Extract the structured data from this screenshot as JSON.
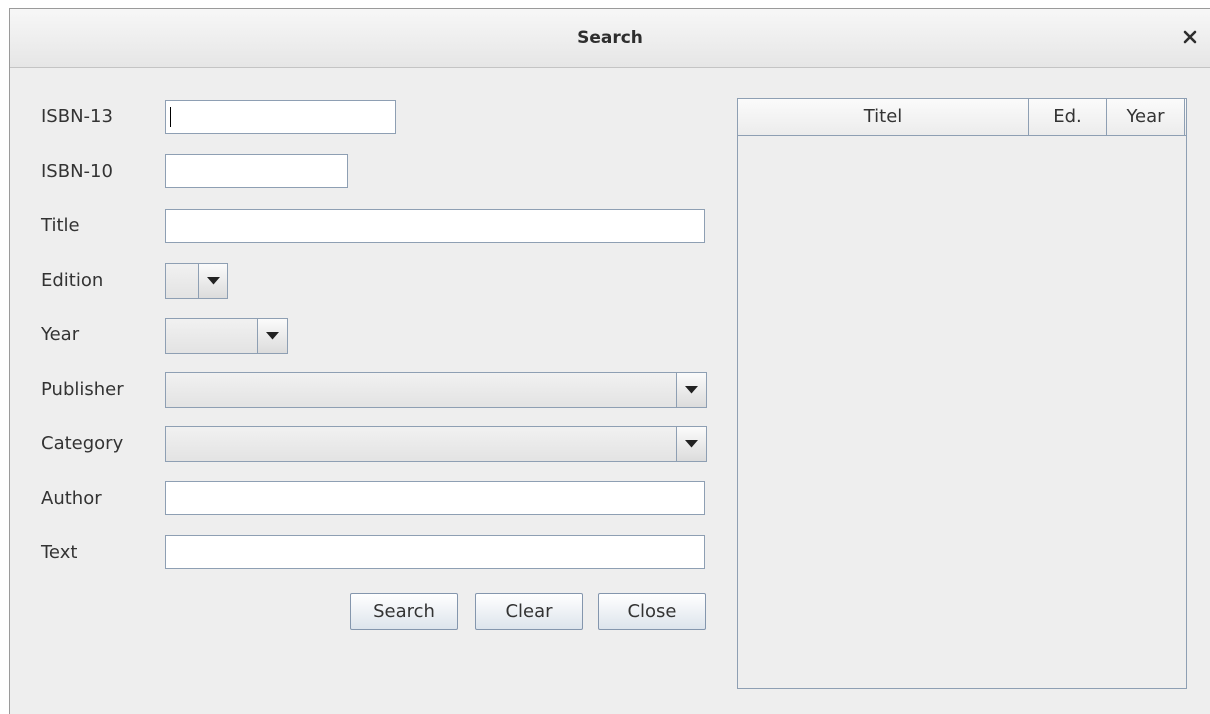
{
  "window": {
    "title": "Search"
  },
  "form": {
    "isbn13": {
      "label": "ISBN-13",
      "value": ""
    },
    "isbn10": {
      "label": "ISBN-10",
      "value": ""
    },
    "title": {
      "label": "Title",
      "value": ""
    },
    "edition": {
      "label": "Edition",
      "selected": ""
    },
    "year": {
      "label": "Year",
      "selected": ""
    },
    "publisher": {
      "label": "Publisher",
      "selected": ""
    },
    "category": {
      "label": "Category",
      "selected": ""
    },
    "author": {
      "label": "Author",
      "value": ""
    },
    "text": {
      "label": "Text",
      "value": ""
    }
  },
  "buttons": {
    "search": "Search",
    "clear": "Clear",
    "close": "Close"
  },
  "results_table": {
    "columns": [
      "Titel",
      "Ed.",
      "Year"
    ],
    "rows": []
  },
  "icons": {
    "close": "close-icon",
    "dropdown": "chevron-down-icon"
  }
}
